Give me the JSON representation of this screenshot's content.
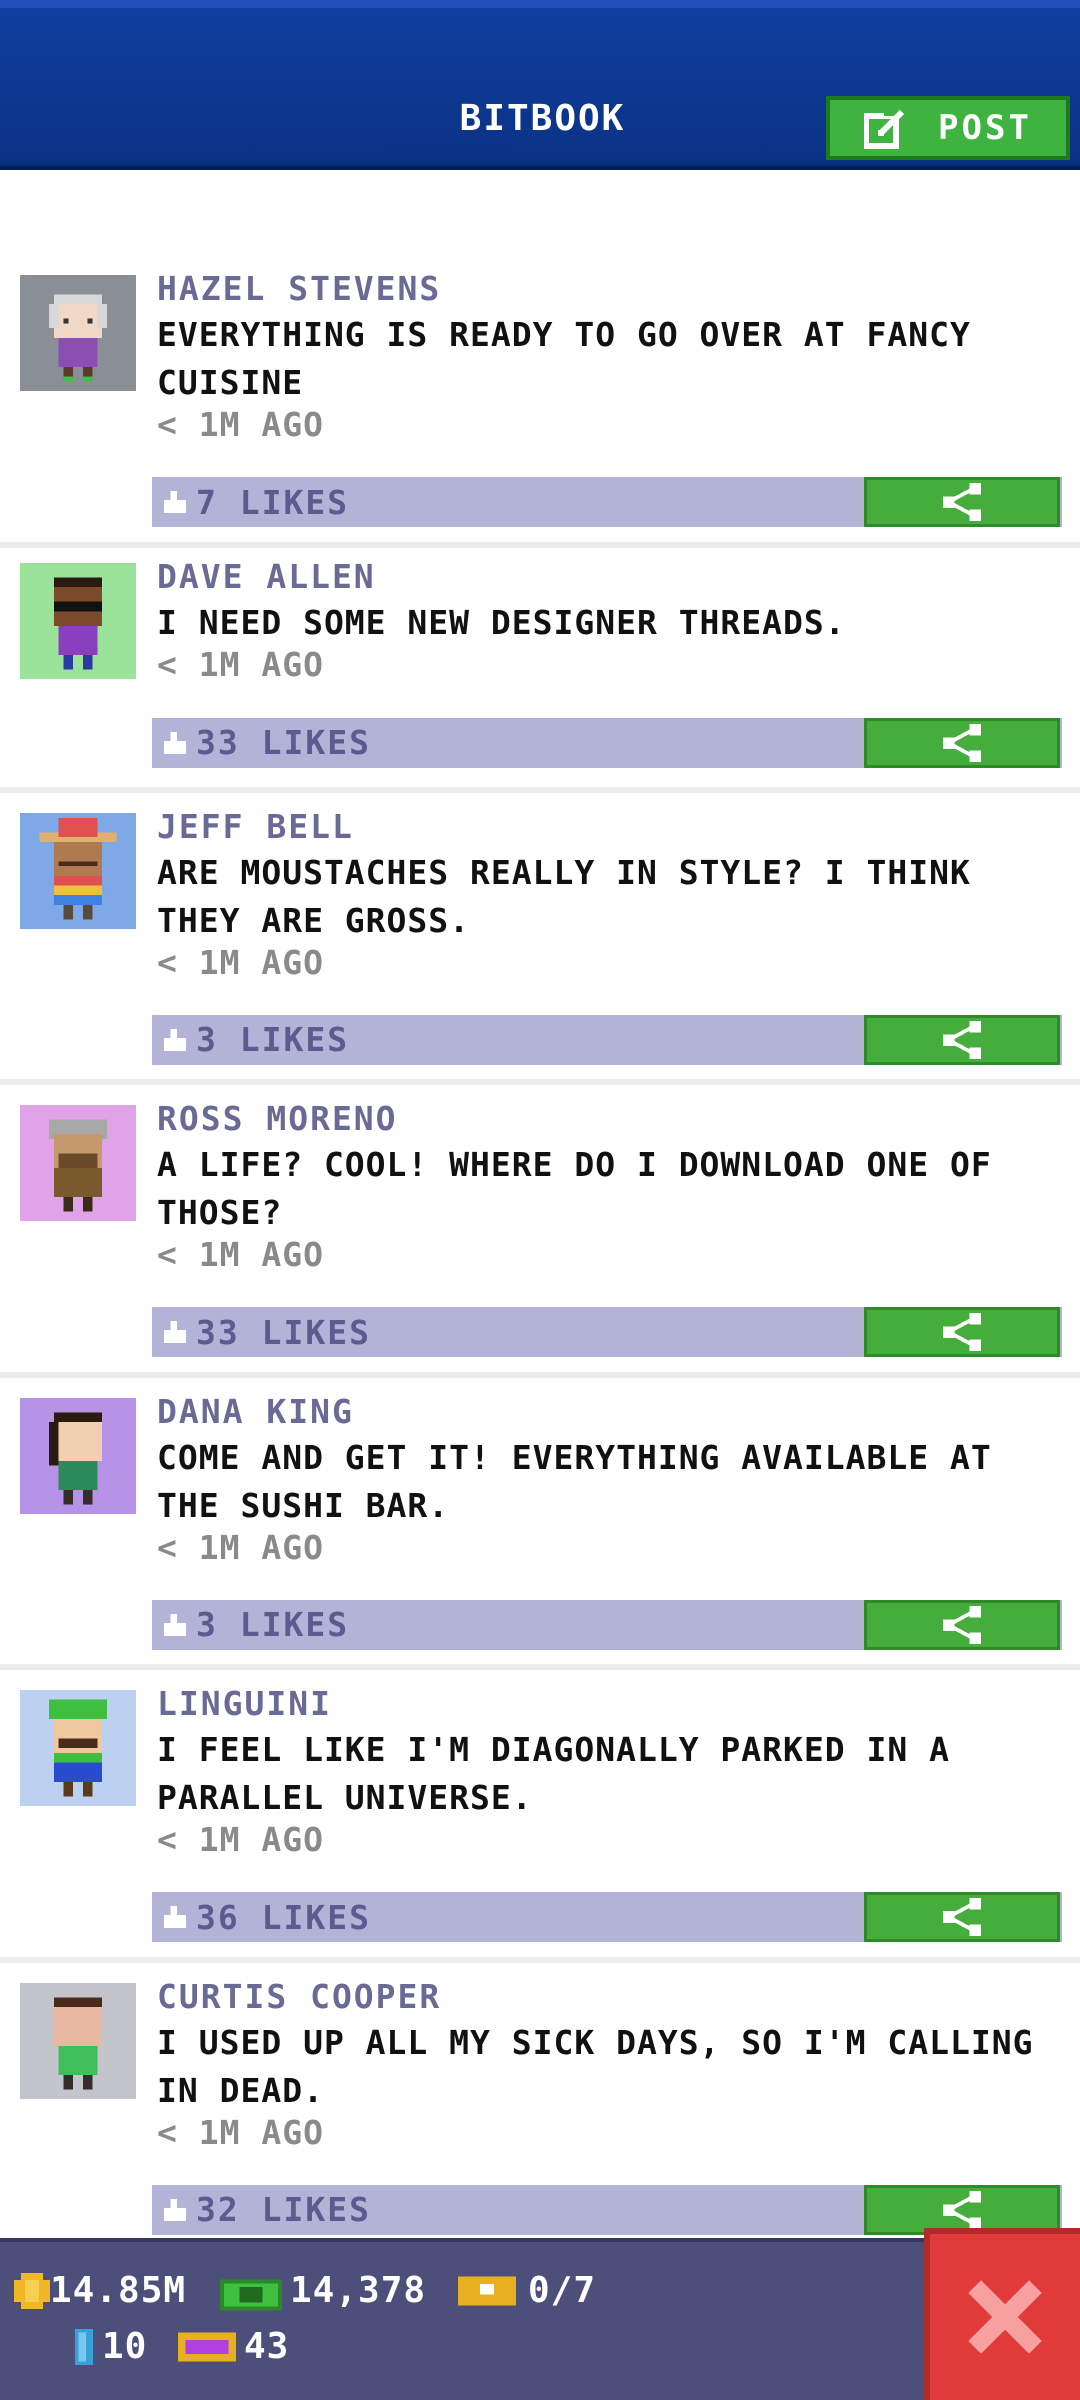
{
  "header": {
    "title": "BITBOOK",
    "post_label": "POST"
  },
  "posts": [
    {
      "author": "HAZEL STEVENS",
      "message": "EVERYTHING IS READY TO GO OVER AT FANCY CUISINE",
      "time": "< 1M AGO",
      "likes": "7 LIKES",
      "avatar_bg": "#8a8f97"
    },
    {
      "author": "DAVE ALLEN",
      "message": "I NEED SOME NEW DESIGNER THREADS.",
      "time": "< 1M AGO",
      "likes": "33 LIKES",
      "avatar_bg": "#9be39b"
    },
    {
      "author": "JEFF BELL",
      "message": "ARE MOUSTACHES REALLY IN STYLE? I THINK THEY ARE GROSS.",
      "time": "< 1M AGO",
      "likes": "3 LIKES",
      "avatar_bg": "#7ea8e6"
    },
    {
      "author": "ROSS MORENO",
      "message": "A LIFE? COOL! WHERE DO I DOWNLOAD ONE OF THOSE?",
      "time": "< 1M AGO",
      "likes": "33 LIKES",
      "avatar_bg": "#e1a3e8"
    },
    {
      "author": "DANA KING",
      "message": "COME AND GET IT! EVERYTHING AVAILABLE AT THE SUSHI BAR.",
      "time": "< 1M AGO",
      "likes": "3 LIKES",
      "avatar_bg": "#b793e8"
    },
    {
      "author": "LINGUINI",
      "message": "I FEEL LIKE I'M DIAGONALLY PARKED IN A PARALLEL UNIVERSE.",
      "time": "< 1M AGO",
      "likes": "36 LIKES",
      "avatar_bg": "#bcd0f0"
    },
    {
      "author": "CURTIS COOPER",
      "message": "I USED UP ALL MY SICK DAYS, SO I'M CALLING IN DEAD.",
      "time": "< 1M AGO",
      "likes": "32 LIKES",
      "avatar_bg": "#c4c4cc"
    }
  ],
  "status": {
    "coins": "14.85M",
    "bux": "14,378",
    "tickets": "0/7",
    "gems": "10",
    "vip": "43"
  },
  "colors": {
    "header_blue": "#0b3386",
    "post_green": "#3fb33f",
    "like_bar": "#b3b3d8",
    "close_red": "#e03a3a"
  }
}
